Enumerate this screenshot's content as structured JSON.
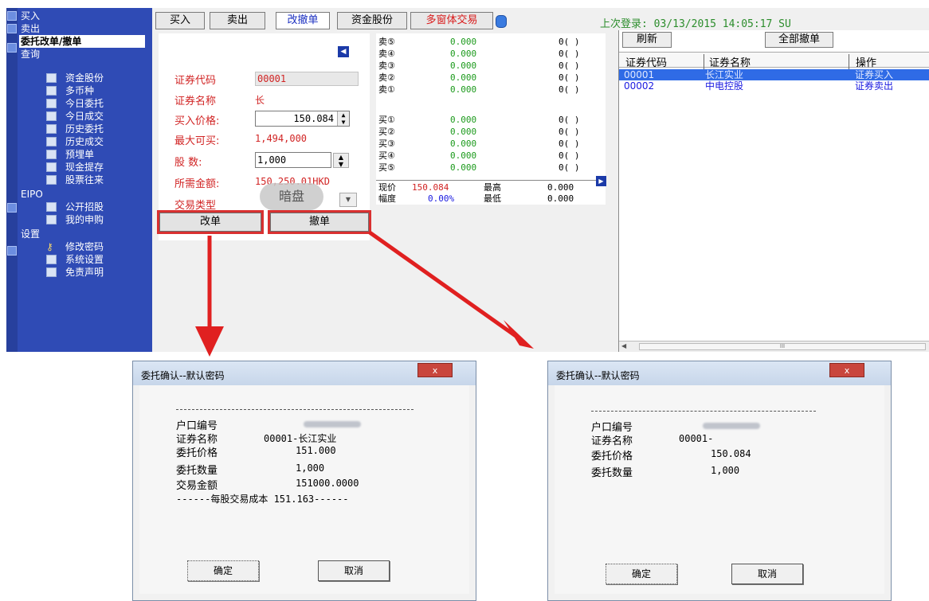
{
  "sidebar": {
    "top_items": [
      "买入",
      "卖出"
    ],
    "selected_item": "委托改单/撤单",
    "query_header": "查询",
    "query_items": [
      "资金股份",
      "多币种",
      "今日委托",
      "今日成交",
      "历史委托",
      "历史成交",
      "预埋单",
      "现金提存",
      "股票往来"
    ],
    "eipo_header": "EIPO",
    "eipo_items": [
      "公开招股",
      "我的申购"
    ],
    "settings_header": "设置",
    "settings_items": [
      "修改密码",
      "系统设置",
      "免责声明"
    ]
  },
  "tabs": [
    "买入",
    "卖出",
    "改撤单",
    "资金股份",
    "多窗体交易"
  ],
  "last_login": "上次登录: 03/13/2015 14:05:17 SU",
  "form": {
    "code_label": "证券代码",
    "code_value": "00001",
    "name_label": "证券名称",
    "name_value": "长",
    "price_label": "买入价格:",
    "price_value": "150.084",
    "max_label": "最大可买:",
    "max_value": "1,494,000",
    "qty_label": "股    数:",
    "qty_value": "1,000",
    "amount_label": "所需金额:",
    "amount_value": "150,250.01HKD",
    "type_label": "交易类型",
    "dark_badge": "暗盘",
    "modify_button": "改单",
    "cancel_button": "撤单"
  },
  "quote": {
    "sell": [
      {
        "name": "卖⑤",
        "price": "0.000",
        "vol": "0(   )"
      },
      {
        "name": "卖④",
        "price": "0.000",
        "vol": "0(   )"
      },
      {
        "name": "卖③",
        "price": "0.000",
        "vol": "0(   )"
      },
      {
        "name": "卖②",
        "price": "0.000",
        "vol": "0(   )"
      },
      {
        "name": "卖①",
        "price": "0.000",
        "vol": "0(   )"
      }
    ],
    "buy": [
      {
        "name": "买①",
        "price": "0.000",
        "vol": "0(   )"
      },
      {
        "name": "买②",
        "price": "0.000",
        "vol": "0(   )"
      },
      {
        "name": "买③",
        "price": "0.000",
        "vol": "0(   )"
      },
      {
        "name": "买④",
        "price": "0.000",
        "vol": "0(   )"
      },
      {
        "name": "买⑤",
        "price": "0.000",
        "vol": "0(   )"
      }
    ],
    "current_label": "现价",
    "current_value": "150.084",
    "high_label": "最高",
    "high_value": "0.000",
    "change_label": "幅度",
    "change_value": "0.00%",
    "low_label": "最低",
    "low_value": "0.000"
  },
  "orders": {
    "refresh_button": "刷新",
    "cancel_all_button": "全部撤单",
    "columns": [
      "证券代码",
      "证券名称",
      "操作"
    ],
    "rows": [
      {
        "code": "00001",
        "name": "长江实业",
        "op": "证券买入"
      },
      {
        "code": "00002",
        "name": "中电控股",
        "op": "证券卖出"
      }
    ],
    "scroll_label": "III"
  },
  "dialog_left": {
    "title": "委托确认--默认密码",
    "close": "x",
    "account_label": "户口编号",
    "name_label": "证券名称",
    "name_value": "00001-长江实业",
    "price_label": "委托价格",
    "price_value": "151.000",
    "qty_label": "委托数量",
    "qty_value": "1,000",
    "amount_label": "交易金额",
    "amount_value": "151000.0000",
    "cost_line": "------每股交易成本 151.163------",
    "ok_button": "确定",
    "cancel_button": "取消"
  },
  "dialog_right": {
    "title": "委托确认--默认密码",
    "close": "x",
    "account_label": "户口编号",
    "name_label": "证券名称",
    "name_value": "00001-",
    "price_label": "委托价格",
    "price_value": "150.084",
    "qty_label": "委托数量",
    "qty_value": "1,000",
    "ok_button": "确定",
    "cancel_button": "取消"
  },
  "colors": {
    "sidebar": "#2f4bb5",
    "red": "#d12424",
    "green": "#1c9a1c",
    "arrow": "#e02020",
    "selection": "#2f6be6"
  }
}
